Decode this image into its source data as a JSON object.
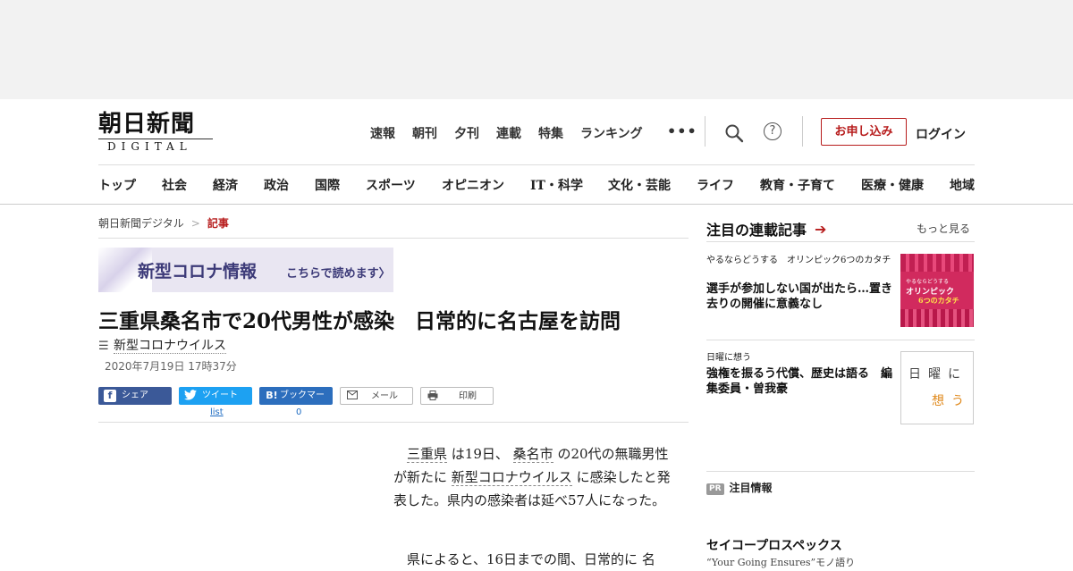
{
  "header": {
    "logo_main": "朝日新聞",
    "logo_sub": "DIGITAL",
    "top_nav": [
      "速報",
      "朝刊",
      "夕刊",
      "連載",
      "特集",
      "ランキング"
    ],
    "more_label": "•••",
    "apply_label": "お申し込み",
    "login_label": "ログイン",
    "help_label": "?",
    "category_nav": [
      "トップ",
      "社会",
      "経済",
      "政治",
      "国際",
      "スポーツ",
      "オピニオン",
      "IT・科学",
      "文化・芸能",
      "ライフ",
      "教育・子育て",
      "医療・健康",
      "地域"
    ]
  },
  "breadcrumb": {
    "home": "朝日新聞デジタル",
    "sep": ">",
    "current": "記事"
  },
  "banner": {
    "title": "新型コロナ情報",
    "link": "こちらで読めます〉"
  },
  "article": {
    "headline": "三重県桑名市で20代男性が感染　日常的に名古屋を訪問",
    "tag": "新型コロナウイルス",
    "date": "2020年7月19日 17時37分",
    "share": {
      "facebook": "シェア",
      "twitter": "ツイート",
      "twitter_count": "list",
      "hatena": "ブックマーク",
      "hatena_icon": "B!",
      "hatena_count": "0",
      "mail": "メール",
      "print": "印刷"
    },
    "para1": {
      "k1": "三重県",
      "t1": " は19日、 ",
      "k2": "桑名市",
      "t2": " の20代の無職男性が新たに ",
      "k3": "新型コロナウイルス",
      "t3": " に感染したと発表した。県内の感染者は延べ57人になった。"
    },
    "para2": "県によると、16日までの間、日常的に 名"
  },
  "sidebar": {
    "title": "注目の連載記事",
    "more": "もっと見る",
    "cards": [
      {
        "category": "やるならどうする　オリンピック6つのカタチ",
        "title": "選手が参加しない国が出たら…置き去りの開催に意義なし"
      },
      {
        "category": "日曜に想う",
        "title": "強権を振るう代償、歴史は語る　編集委員・曽我豪"
      }
    ],
    "thumb1": {
      "line1": "やるならどうする",
      "line2": "オリンピック",
      "line3": "6つのカタチ"
    },
    "thumb2": {
      "line1": "日曜に",
      "line2": "想う"
    },
    "pr_badge": "PR",
    "pr_label": "注目情報",
    "promo_title": "セイコープロスペックス",
    "promo_sub": "“Your Going Ensures”モノ語り"
  },
  "colors": {
    "accent": "#b71c1c",
    "facebook": "#3b5998",
    "twitter": "#1da1f2",
    "hatena": "#2c6ebd"
  }
}
